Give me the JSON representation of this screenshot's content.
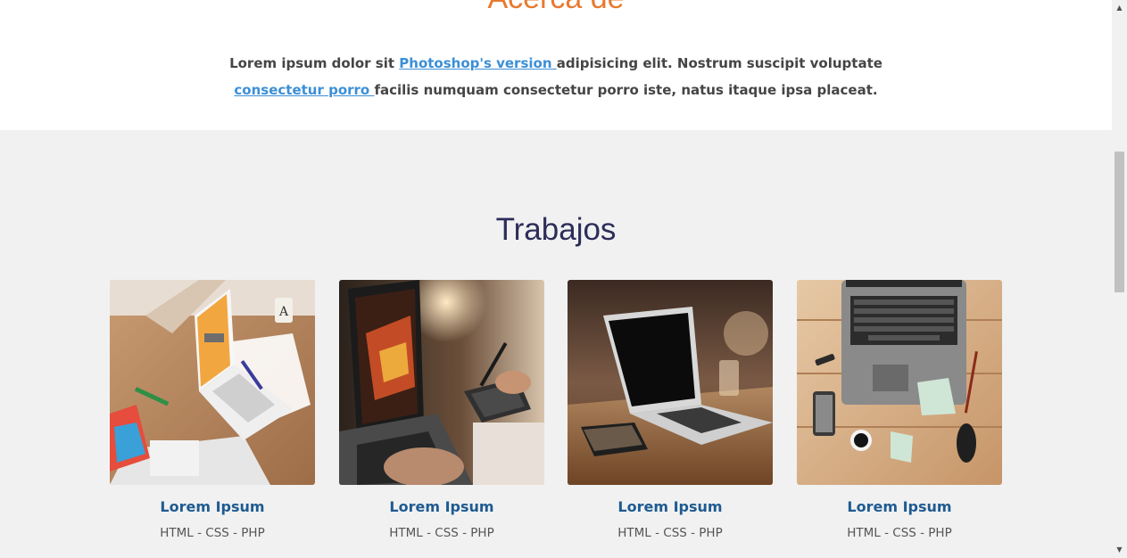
{
  "about": {
    "title": "Acerca de",
    "text_1": "Lorem ipsum dolor sit ",
    "link_1": "Photoshop's version ",
    "text_2": "adipisicing elit. Nostrum suscipit voluptate ",
    "link_2": "consectetur porro ",
    "text_3": "facilis numquam consectetur porro iste, natus itaque ipsa placeat."
  },
  "works": {
    "title": "Trabajos",
    "items": [
      {
        "title": "Lorem Ipsum",
        "subtitle": "HTML - CSS - PHP",
        "image": "white-laptop-desk-photo"
      },
      {
        "title": "Lorem Ipsum",
        "subtitle": "HTML - CSS - PHP",
        "image": "laptop-drawing-tablet-photo"
      },
      {
        "title": "Lorem Ipsum",
        "subtitle": "HTML - CSS - PHP",
        "image": "laptop-cafe-table-photo"
      },
      {
        "title": "Lorem Ipsum",
        "subtitle": "HTML - CSS - PHP",
        "image": "laptop-wooden-desk-photo"
      }
    ]
  },
  "colors": {
    "accent_orange": "#e8792e",
    "link_blue": "#3c8fd6",
    "card_title_blue": "#1e5b91",
    "heading_navy": "#2d2d5a",
    "section_gray": "#f1f1f1"
  }
}
